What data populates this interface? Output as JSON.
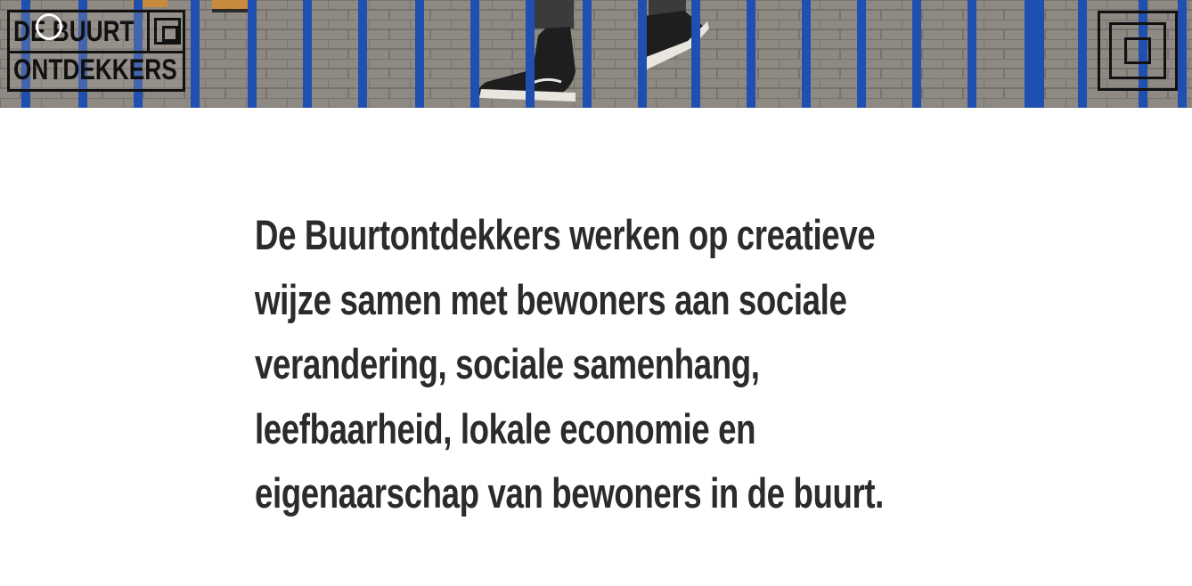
{
  "header": {
    "logo": {
      "line1": "DE BUURT",
      "line2": "ONTDEKKERS"
    },
    "menu_button": {
      "icon": "nested-squares-icon"
    }
  },
  "intro": {
    "lines": [
      "De Buurtontdekkers werken op creatieve",
      "wijze samen met bewoners aan sociale",
      "verandering, sociale samenhang,",
      "leefbaarheid, lokale economie en",
      "eigenaarschap van bewoners in de buurt."
    ]
  },
  "colors": {
    "fence_blue": "#1f4fb0",
    "pavement": "#8d8a84",
    "text": "#2b2b2b",
    "background": "#ffffff"
  }
}
